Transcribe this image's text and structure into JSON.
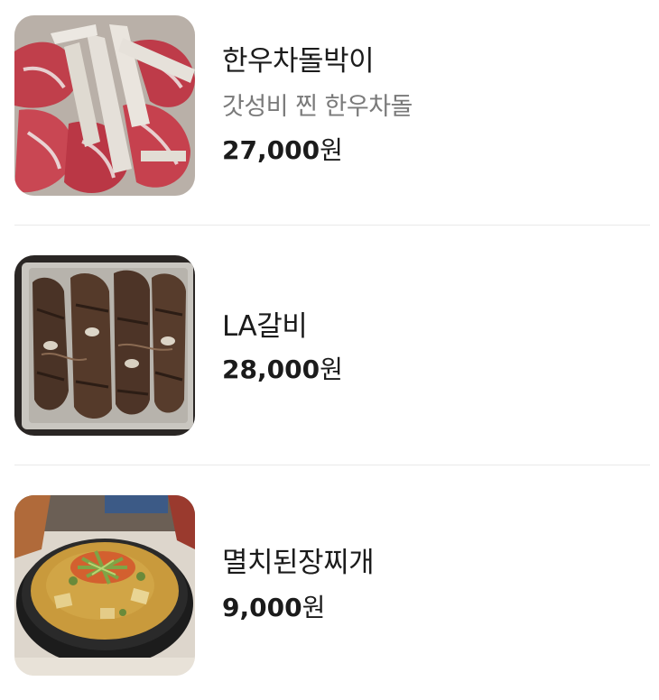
{
  "menu": {
    "items": [
      {
        "name": "한우차돌박이",
        "description": "갓성비 찐 한우차돌",
        "price": "27,000",
        "currency": "원",
        "image_icon": "beef-brisket-photo-icon"
      },
      {
        "name": "LA갈비",
        "price": "28,000",
        "currency": "원",
        "image_icon": "grilled-ribs-photo-icon"
      },
      {
        "name": "멸치된장찌개",
        "price": "9,000",
        "currency": "원",
        "image_icon": "soybean-stew-photo-icon"
      }
    ]
  },
  "colors": {
    "text_primary": "#1b1b1b",
    "text_secondary": "#7a7a7a",
    "divider": "#e9e9e9"
  }
}
